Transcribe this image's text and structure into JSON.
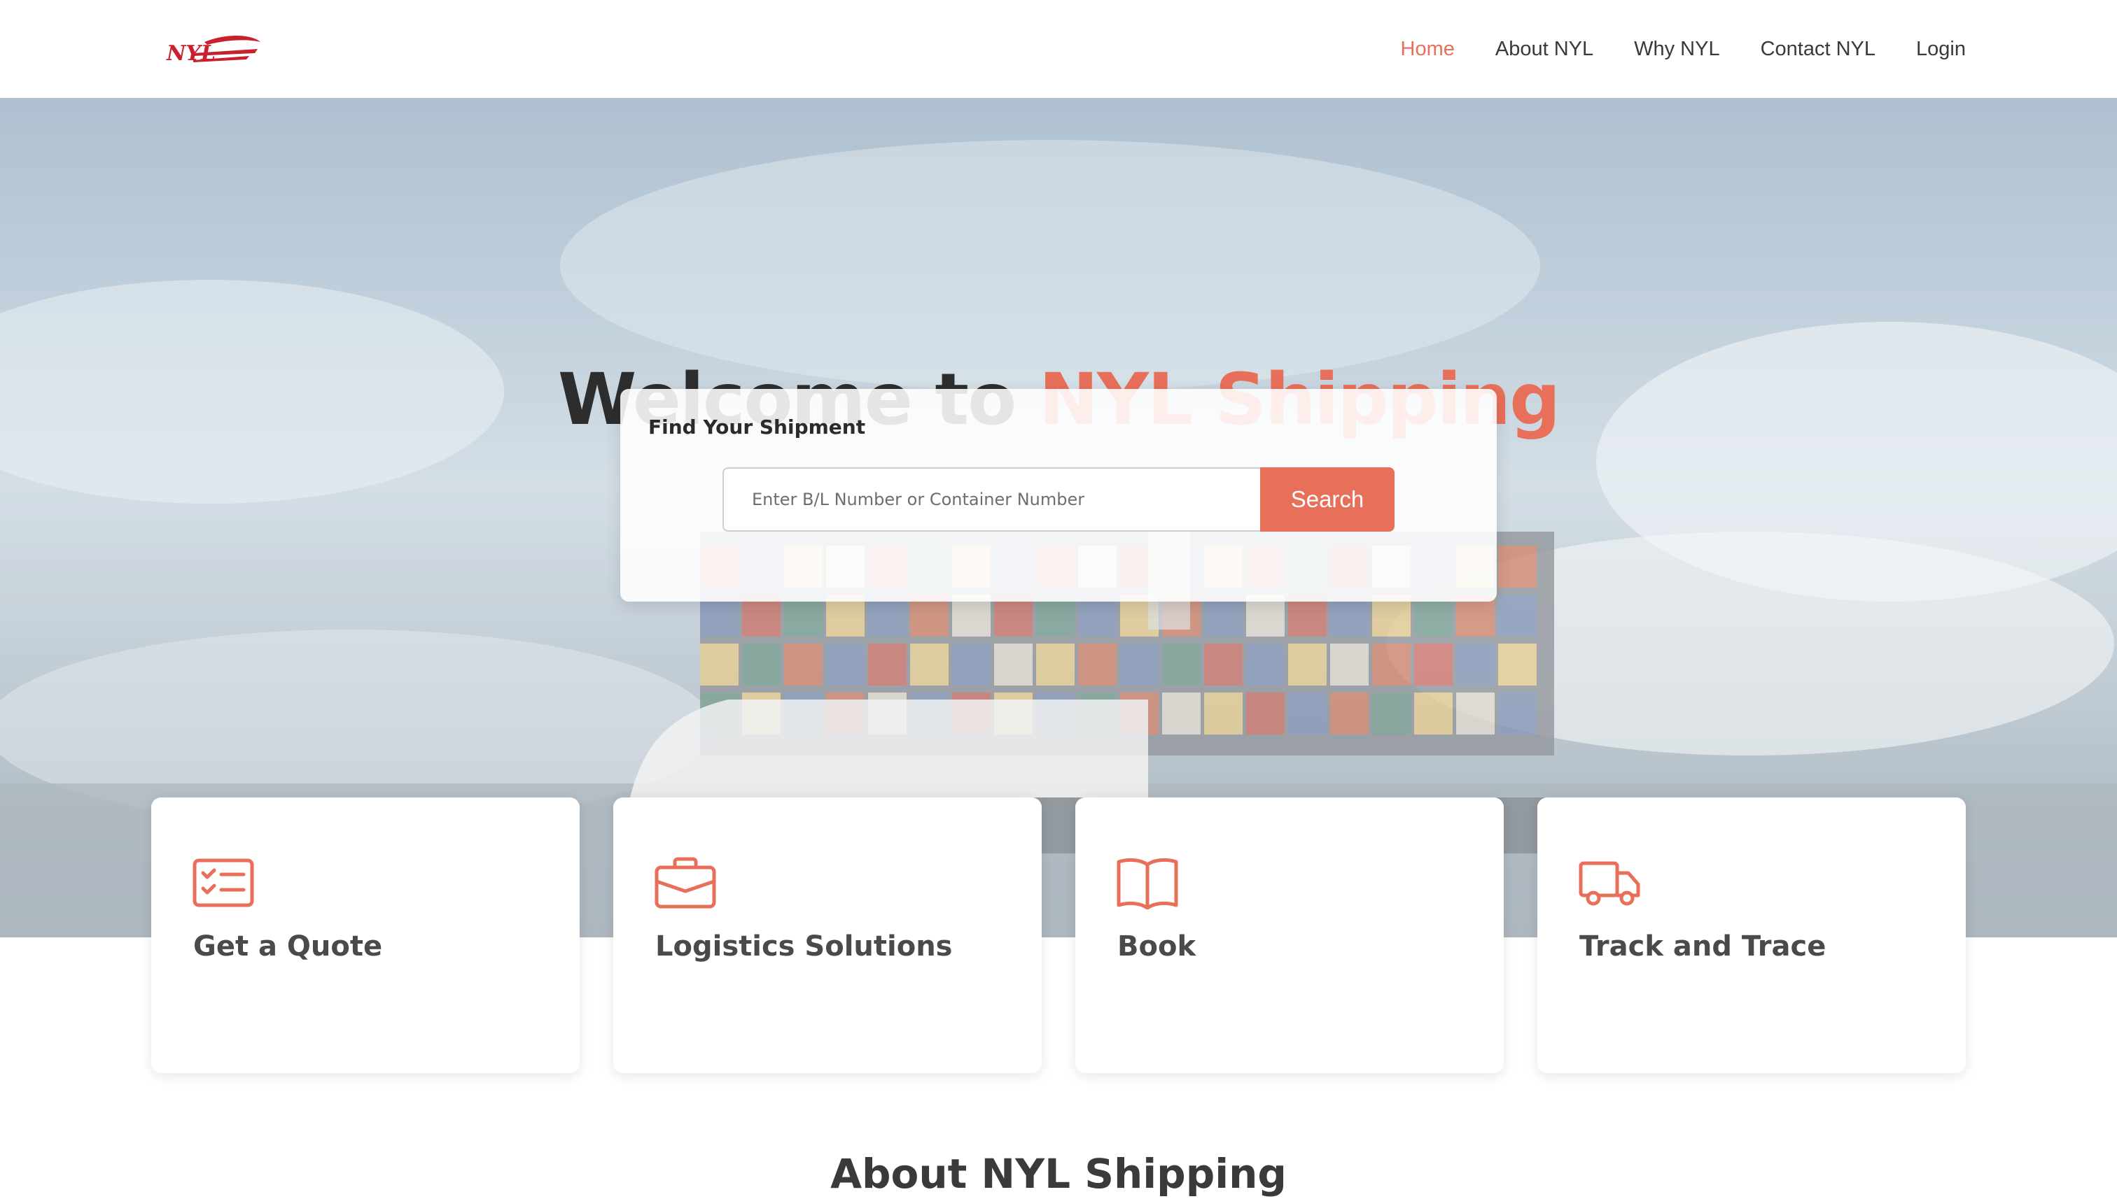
{
  "header": {
    "logo_text": "NYL",
    "nav": [
      {
        "label": "Home",
        "active": true
      },
      {
        "label": "About NYL",
        "active": false
      },
      {
        "label": "Why NYL",
        "active": false
      },
      {
        "label": "Contact NYL",
        "active": false
      },
      {
        "label": "Login",
        "active": false
      }
    ]
  },
  "hero": {
    "title_prefix": "Welcome to",
    "title_brand": "NYL Shipping",
    "search": {
      "label": "Find Your Shipment",
      "placeholder": "Enter B/L Number or Container Number",
      "value": "",
      "button_label": "Search"
    }
  },
  "cards": [
    {
      "title": "Get a Quote",
      "icon": "checklist-icon"
    },
    {
      "title": "Logistics Solutions",
      "icon": "briefcase-icon"
    },
    {
      "title": "Book",
      "icon": "open-book-icon"
    },
    {
      "title": "Track and Trace",
      "icon": "truck-icon"
    }
  ],
  "about": {
    "title": "About NYL Shipping"
  },
  "colors": {
    "accent": "#e8705a",
    "text_dark": "#2d2d2d",
    "logo_red": "#c8202c"
  }
}
